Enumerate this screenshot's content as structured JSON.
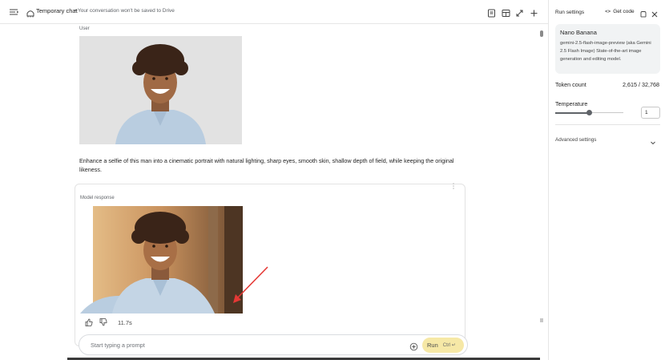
{
  "topbar": {
    "title": "Temporary chat",
    "subtitle": "• Your conversation won't be saved to Drive",
    "icons": [
      "menu-icon",
      "chat-bubble-icon",
      "doc-icon",
      "table-icon",
      "compare-icon",
      "plus-icon"
    ]
  },
  "conversation": {
    "user_label": "User",
    "prompt": "Enhance a selfie of this man into a cinematic portrait with natural lighting, sharp eyes, smooth skin, shallow depth of field, while keeping the original likeness.",
    "response_label": "Model response",
    "response_time": "11.7s"
  },
  "input": {
    "placeholder": "Start typing a prompt",
    "run_label": "Run",
    "run_shortcut": "Ctrl ↵"
  },
  "panel": {
    "title": "Run settings",
    "get_code": "Get code",
    "model_name": "Nano Banana",
    "model_desc": "gemini-2.5-flash-image-preview (aka Gemini 2.5 Flash Image) State-of-the-art image generation and editing model.",
    "token_label": "Token count",
    "token_value": "2,615 / 32,768",
    "temperature_label": "Temperature",
    "temperature_value": "1",
    "temperature_fraction": 0.5,
    "advanced_label": "Advanced settings"
  },
  "colors": {
    "run_button": "#f6e8a6",
    "annotation_arrow": "#e53935"
  }
}
